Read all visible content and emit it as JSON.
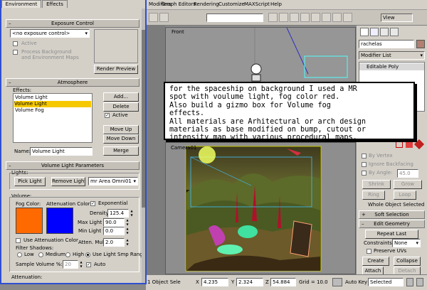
{
  "menu": {
    "items": [
      "Modifiers",
      "Graph Editors",
      "Rendering",
      "Customize",
      "MAXScript",
      "Help"
    ]
  },
  "toolbar": {
    "view_dropdown": "View"
  },
  "viewports": {
    "front_label": "Front",
    "camera_label": "Camera01"
  },
  "command_panel": {
    "object_name": "rachelas",
    "modifier_list": "Modifier List",
    "stack_item": "Editable Poly",
    "selection": {
      "by_vertex": "By Vertex",
      "ignore_backfacing": "Ignore Backfacing",
      "by_angle": "By Angle:",
      "by_angle_value": "45.0",
      "shrink": "Shrink",
      "grow": "Grow",
      "ring": "Ring",
      "loop": "Loop",
      "status": "Whole Object Selected"
    },
    "soft_selection": "Soft Selection",
    "edit_geometry": "Edit Geometry",
    "repeat_last": "Repeat Last",
    "constraints_label": "Constraints:",
    "constraints_value": "None",
    "preserve_uvs": "Preserve UVs",
    "create": "Create",
    "collapse": "Collapse",
    "attach": "Attach",
    "detach": "Detach"
  },
  "status": {
    "object_sel": "1 Object Sele",
    "x": "4.235",
    "y": "2.324",
    "z": "54.884",
    "grid": "Grid = 10.0",
    "auto_key": "Auto Key",
    "selected": "Selected"
  },
  "dialog": {
    "tabs": [
      "Environment",
      "Effects"
    ],
    "exposure": {
      "title": "Exposure Control",
      "dropdown": "<no exposure control>",
      "active": "Active",
      "process_bg": "Process Background",
      "env_maps": "and Environment Maps",
      "render_preview": "Render Preview"
    },
    "atmosphere": {
      "title": "Atmosphere",
      "effects_label": "Effects:",
      "effects": [
        "Volume Light",
        "Volume Light",
        "Volume Fog"
      ],
      "selected_index": 1,
      "add": "Add...",
      "delete": "Delete",
      "active": "Active",
      "move_up": "Move Up",
      "move_down": "Move Down",
      "name_label": "Name:",
      "name_value": "Volume Light",
      "merge": "Merge"
    },
    "vlp": {
      "title": "Volume Light Parameters",
      "lights_label": "Lights:",
      "pick_light": "Pick Light",
      "remove_light": "Remove Light",
      "light_dropdown": "mr Area Omni01",
      "volume_label": "Volume:",
      "fog_color_label": "Fog Color:",
      "atten_color_label": "Attenuation Color:",
      "fog_color": "#ff6a00",
      "atten_color": "#0000ff",
      "exponential": "Exponential",
      "density_label": "Density:",
      "density": "125.4",
      "max_light_label": "Max Light %:",
      "max_light": "90.0",
      "min_light_label": "Min Light %:",
      "min_light": "0.0",
      "atten_mult_label": "Atten. Mult.:",
      "atten_mult": "2.0",
      "use_atten_color": "Use Attenuation Color",
      "filter_shadows": "Filter Shadows:",
      "low": "Low",
      "medium": "Medium",
      "high": "High",
      "use_light_smp": "Use Light Smp Range",
      "sample_volume_label": "Sample Volume %:",
      "sample_volume": "20",
      "auto": "Auto",
      "attenuation_label": "Attenuation:"
    }
  },
  "note": {
    "text": "for the spaceship on background I used a MR\nspot with voulume light, fog color red.\nAlso build a gizmo box for Volume fog\neffects.\nAll materials are Arhitectural or arch design\nmaterials as base modified on bump, cutout or\nintensity map with various procedural maps."
  }
}
